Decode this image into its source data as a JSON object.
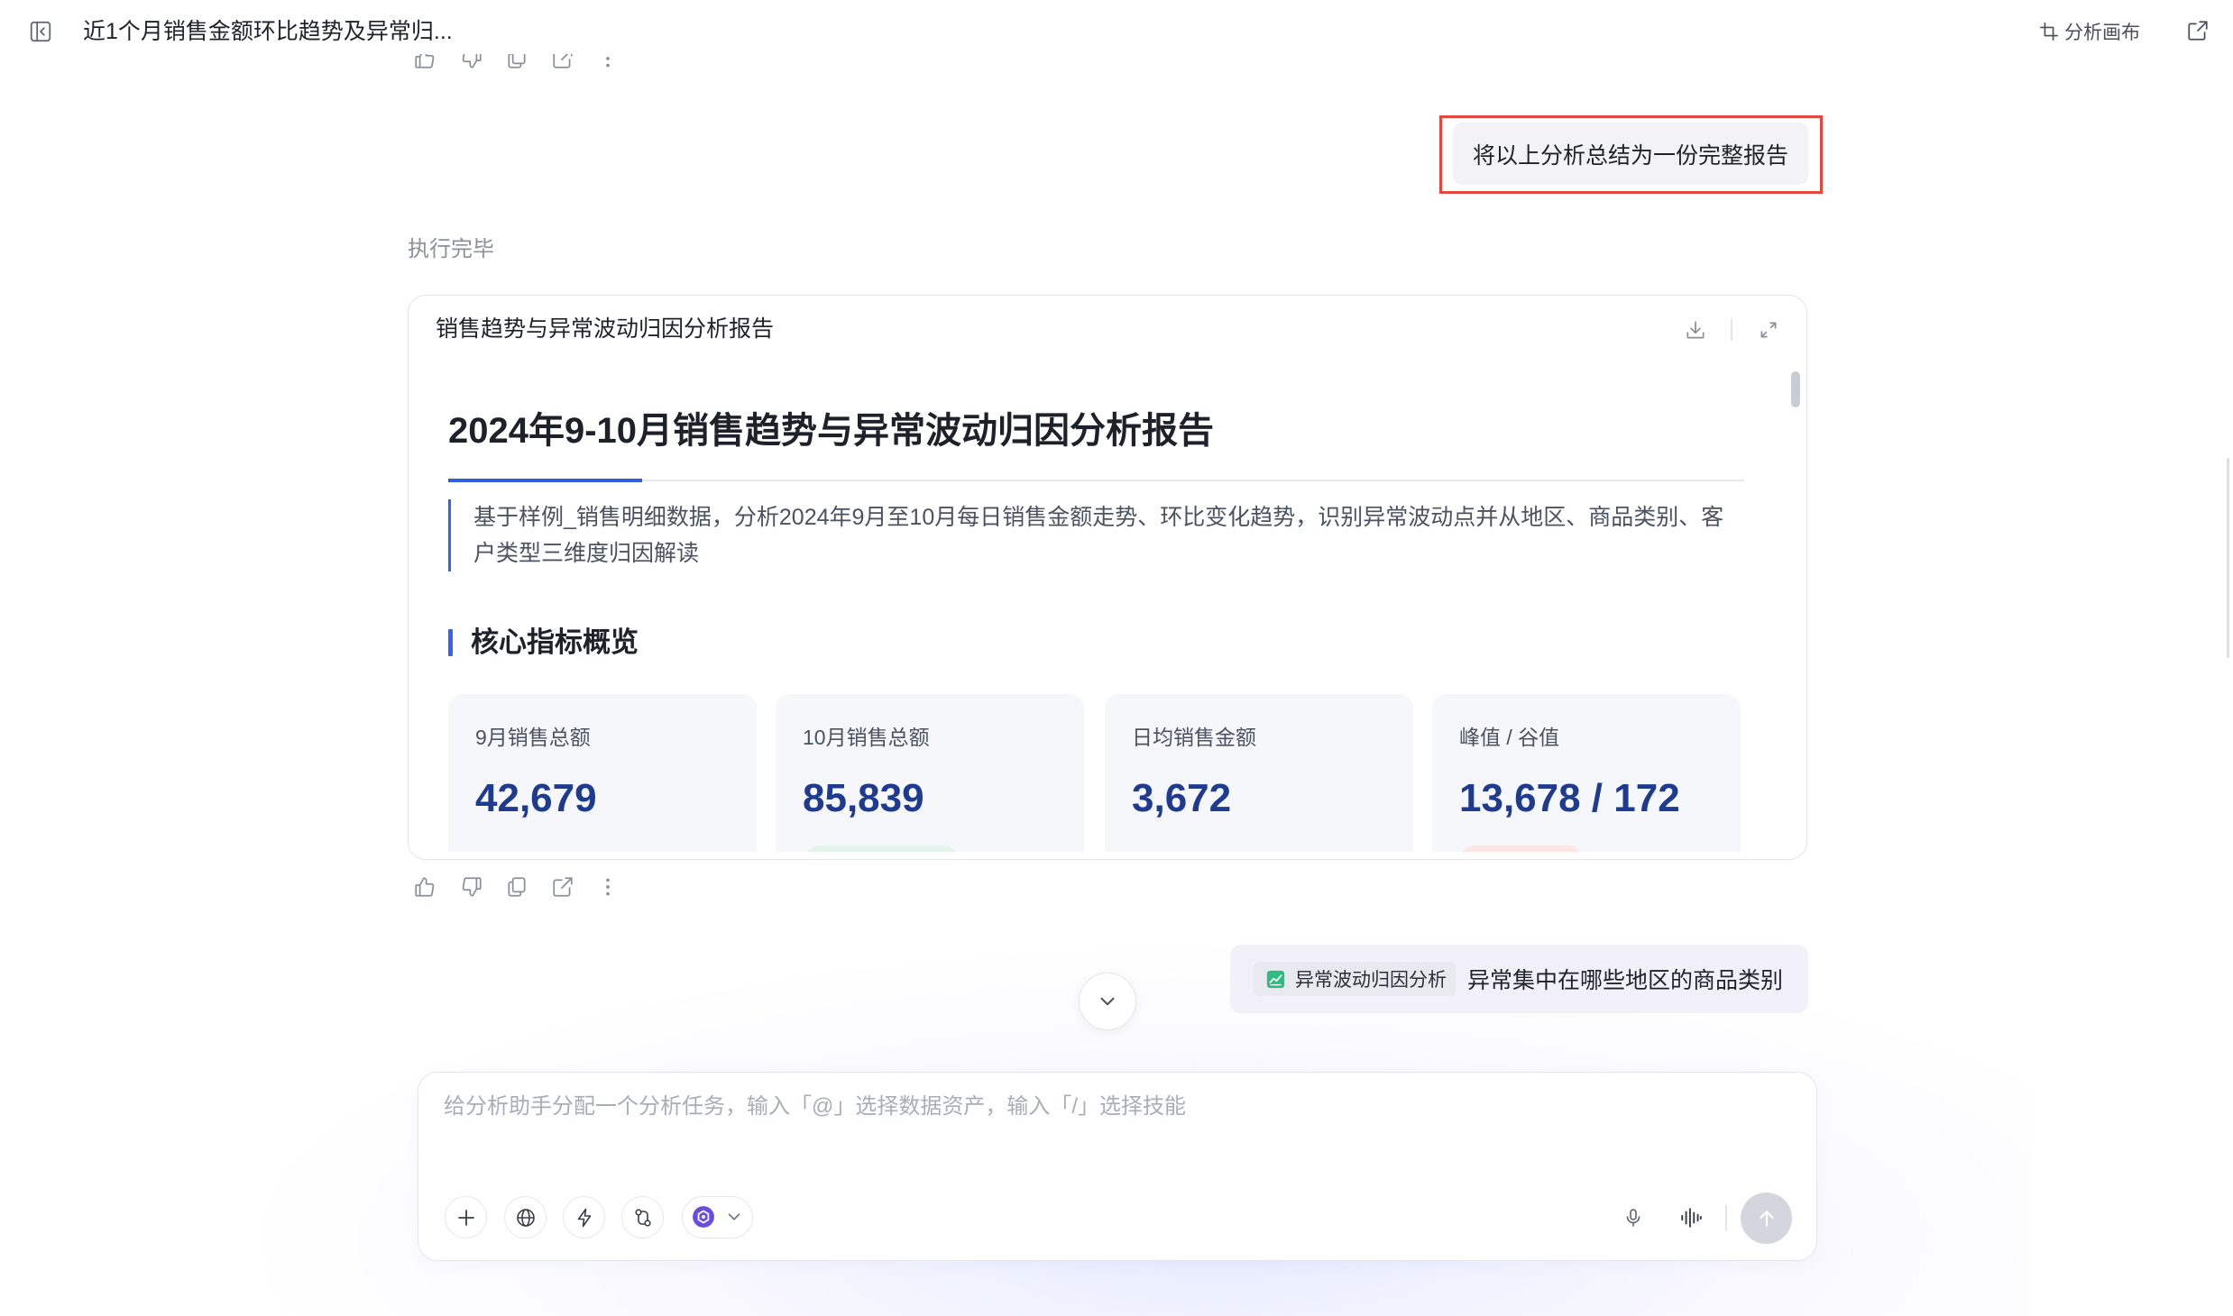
{
  "header": {
    "title": "近1个月销售金额环比趋势及异常归...",
    "canvas_label": "分析画布"
  },
  "conversation": {
    "user_request": "将以上分析总结为一份完整报告",
    "status": "执行完毕",
    "followup": {
      "skill_tag": "异常波动归因分析",
      "text": "异常集中在哪些地区的商品类别"
    }
  },
  "report": {
    "card_title": "销售趋势与异常波动归因分析报告",
    "title": "2024年9-10月销售趋势与异常波动归因分析报告",
    "summary": "基于样例_销售明细数据，分析2024年9月至10月每日销售金额走势、环比变化趋势，识别异常波动点并从地区、商品类别、客户类型三维度归因解读",
    "section_heading": "核心指标概览",
    "metrics": [
      {
        "label": "9月销售总额",
        "value": "42,679"
      },
      {
        "label": "10月销售总额",
        "value": "85,839"
      },
      {
        "label": "日均销售金额",
        "value": "3,672"
      },
      {
        "label": "峰值 / 谷值",
        "value": "13,678 / 172"
      }
    ]
  },
  "composer": {
    "placeholder": "给分析助手分配一个分析任务，输入「@」选择数据资产，输入「/」选择技能"
  },
  "icons": {
    "header": [
      "sidebar-toggle-icon",
      "canvas-icon",
      "open-external-icon"
    ],
    "report_card": [
      "download-icon",
      "expand-icon"
    ],
    "message_actions": [
      "thumbs-up-icon",
      "thumbs-down-icon",
      "copy-icon",
      "share-icon",
      "more-icon"
    ],
    "composer": [
      "plus-icon",
      "globe-icon",
      "lightning-icon",
      "workflow-icon",
      "model-icon",
      "chevron-down-icon",
      "microphone-icon",
      "waveform-icon",
      "arrow-up-icon"
    ]
  },
  "colors": {
    "accent": "#3763e8",
    "metric_value": "#1f3b8f",
    "highlight_border": "#e5463d",
    "skill_tag_icon": "#2dbd7e",
    "model_icon": "#6a4ce0",
    "send_button": "#d3d6dd"
  }
}
